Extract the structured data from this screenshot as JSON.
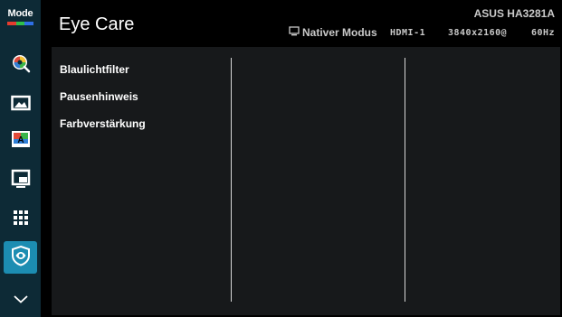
{
  "sidebar": {
    "mode_label": "Mode",
    "mode_bar_colors": [
      "#e63c2f",
      "#2fbf4a",
      "#2f6fe6"
    ],
    "items": [
      {
        "icon": "splendid-icon"
      },
      {
        "icon": "image-icon"
      },
      {
        "icon": "color-icon"
      },
      {
        "icon": "input-select-icon"
      },
      {
        "icon": "system-setup-icon"
      },
      {
        "icon": "eye-care-icon"
      },
      {
        "icon": "chevron-down-icon"
      }
    ]
  },
  "header": {
    "title": "Eye Care",
    "model": "ASUS HA3281A",
    "mode_status": "Nativer Modus",
    "input": "HDMI-1",
    "resolution": "3840x2160@",
    "refresh": "60Hz"
  },
  "menu": {
    "items": [
      "Blaulichtfilter",
      "Pausenhinweis",
      "Farbverstärkung"
    ]
  },
  "colors": {
    "accent": "#1c8db2",
    "sidebar_bg": "#0d2a36",
    "panel_bg": "#17191b"
  }
}
